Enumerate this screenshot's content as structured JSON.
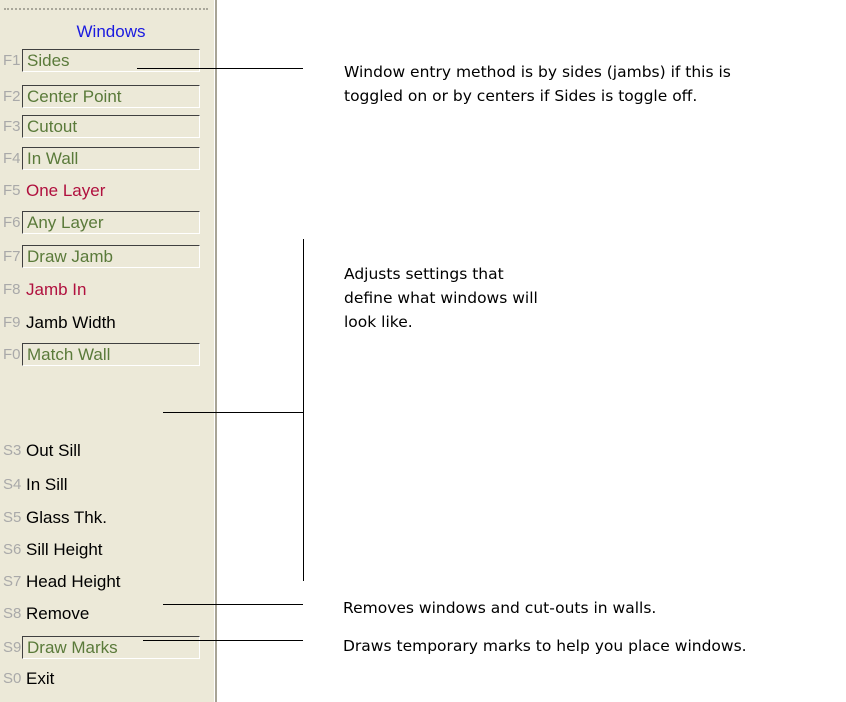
{
  "menu": {
    "title": "Windows",
    "items": [
      {
        "key": "F1",
        "label": "Sides",
        "style": "toggle"
      },
      {
        "key": "F2",
        "label": "Center Point",
        "style": "toggle"
      },
      {
        "key": "F3",
        "label": "Cutout",
        "style": "toggle"
      },
      {
        "key": "F4",
        "label": "In Wall",
        "style": "toggle"
      },
      {
        "key": "F5",
        "label": "One Layer",
        "style": "red"
      },
      {
        "key": "F6",
        "label": "Any Layer",
        "style": "toggle"
      },
      {
        "key": "F7",
        "label": "Draw Jamb",
        "style": "toggle"
      },
      {
        "key": "F8",
        "label": "Jamb In",
        "style": "red"
      },
      {
        "key": "F9",
        "label": "Jamb Width",
        "style": "plain"
      },
      {
        "key": "F0",
        "label": "Match Wall",
        "style": "toggle"
      },
      {
        "key": "S3",
        "label": "Out Sill",
        "style": "plain"
      },
      {
        "key": "S4",
        "label": "In Sill",
        "style": "plain"
      },
      {
        "key": "S5",
        "label": "Glass Thk.",
        "style": "plain"
      },
      {
        "key": "S6",
        "label": "Sill Height",
        "style": "plain"
      },
      {
        "key": "S7",
        "label": "Head Height",
        "style": "plain"
      },
      {
        "key": "S8",
        "label": "Remove",
        "style": "plain"
      },
      {
        "key": "S9",
        "label": "Draw Marks",
        "style": "toggle"
      },
      {
        "key": "S0",
        "label": "Exit",
        "style": "plain"
      }
    ]
  },
  "annotations": {
    "sides_note_line1": "Window entry method is by sides (jambs) if this is",
    "sides_note_line2": "toggled on or by centers if Sides is toggle off.",
    "settings_note_line1": "Adjusts settings that",
    "settings_note_line2": "define what windows will",
    "settings_note_line3": "look like.",
    "remove_note": "Removes windows and cut-outs in walls.",
    "marks_note": "Draws temporary marks to help you place windows."
  },
  "colors": {
    "menu_background": "#ece9d8",
    "title_blue": "#1a1ae0",
    "toggle_green": "#5a7a3a",
    "active_red": "#b0103e",
    "key_gray": "#a9a9a9"
  }
}
